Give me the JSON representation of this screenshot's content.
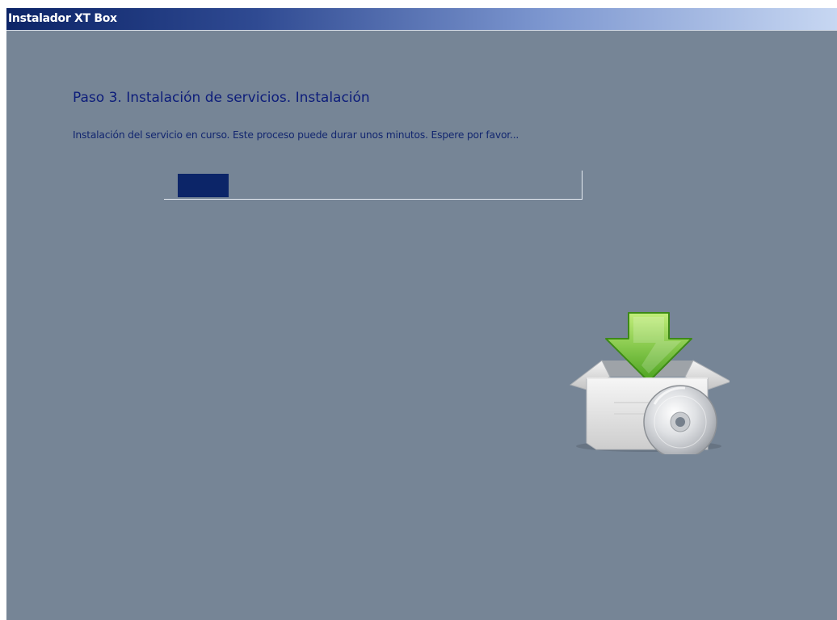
{
  "window": {
    "title": "Instalador XT Box"
  },
  "step": {
    "heading": "Paso 3. Instalación de servicios. Instalación",
    "description": "Instalación del servicio en curso. Este proceso puede durar unos minutos. Espere por favor..."
  },
  "progress": {
    "percent": 13
  },
  "icons": {
    "illustration": "box-with-download-arrow-and-cd-icon"
  },
  "colors": {
    "background": "#768596",
    "heading": "#0d1d7a",
    "progress_fill": "#0c2568"
  }
}
